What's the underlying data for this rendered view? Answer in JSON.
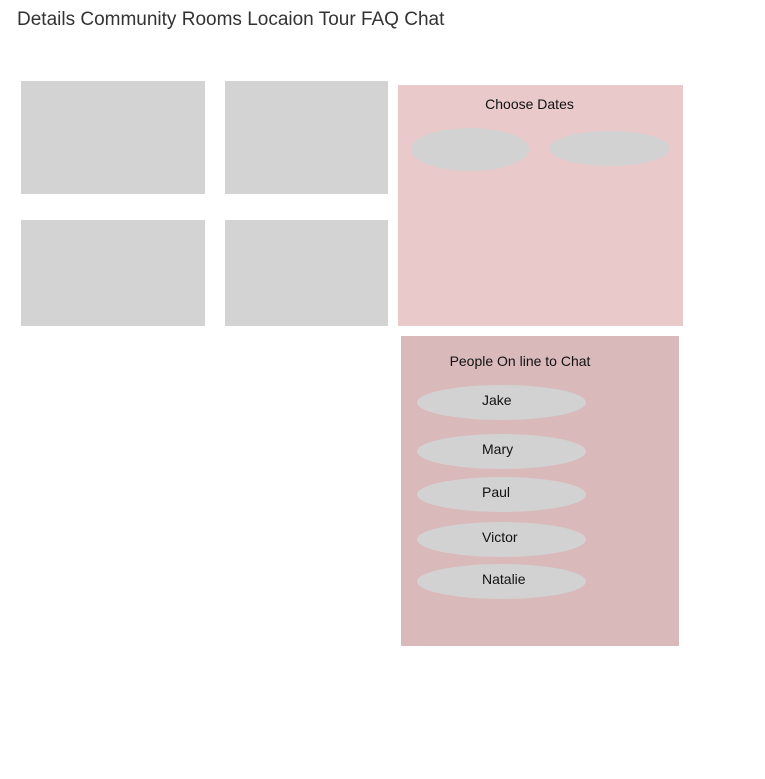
{
  "nav": {
    "items": [
      {
        "label": "Details"
      },
      {
        "label": "Community"
      },
      {
        "label": "Rooms"
      },
      {
        "label": "Locaion"
      },
      {
        "label": "Tour"
      },
      {
        "label": "FAQ"
      },
      {
        "label": "Chat"
      }
    ]
  },
  "dates": {
    "title": "Choose Dates"
  },
  "chat": {
    "title": "People On line to Chat",
    "people": [
      {
        "name": "Jake"
      },
      {
        "name": "Mary"
      },
      {
        "name": "Paul"
      },
      {
        "name": "Victor"
      },
      {
        "name": "Natalie"
      }
    ]
  },
  "colors": {
    "placeholder": "#d3d3d3",
    "dates_panel": "#e9c9ca",
    "chat_panel": "#dab9bb"
  }
}
